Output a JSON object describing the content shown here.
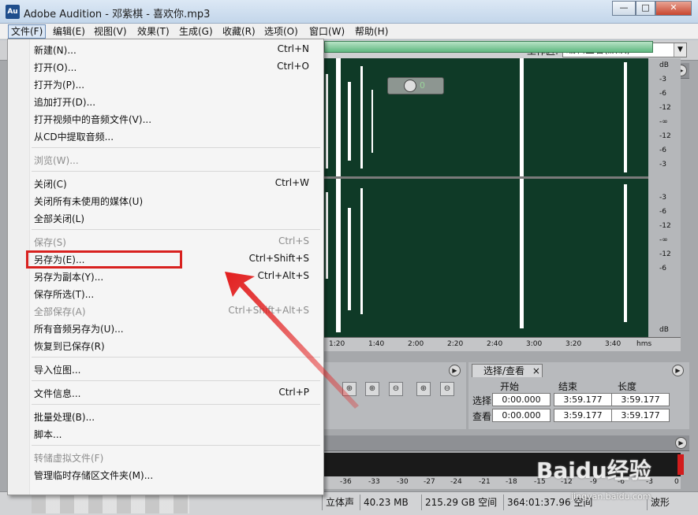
{
  "window": {
    "title": "Adobe Audition - 邓紫棋 - 喜欢你.mp3",
    "icon_text": "Au",
    "controls": {
      "minimize": "—",
      "maximize": "□",
      "close": "✕"
    }
  },
  "menubar": [
    {
      "label": "文件(F)",
      "active": true
    },
    {
      "label": "编辑(E)"
    },
    {
      "label": "视图(V)"
    },
    {
      "label": "效果(T)"
    },
    {
      "label": "生成(G)"
    },
    {
      "label": "收藏(R)"
    },
    {
      "label": "选项(O)"
    },
    {
      "label": "窗口(W)"
    },
    {
      "label": "帮助(H)"
    }
  ],
  "workspace": {
    "label": "工作区:",
    "value": "编辑查看(默认)"
  },
  "file_menu": [
    {
      "label": "新建(N)...",
      "shortcut": "Ctrl+N"
    },
    {
      "label": "打开(O)...",
      "shortcut": "Ctrl+O"
    },
    {
      "label": "打开为(P)...",
      "shortcut": ""
    },
    {
      "label": "追加打开(D)...",
      "shortcut": ""
    },
    {
      "label": "打开视频中的音频文件(V)...",
      "shortcut": ""
    },
    {
      "label": "从CD中提取音频...",
      "shortcut": ""
    },
    {
      "label": "浏览(W)...",
      "shortcut": "",
      "disabled": true
    },
    {
      "label": "关闭(C)",
      "shortcut": "Ctrl+W"
    },
    {
      "label": "关闭所有未使用的媒体(U)",
      "shortcut": ""
    },
    {
      "label": "全部关闭(L)",
      "shortcut": ""
    },
    {
      "label": "保存(S)",
      "shortcut": "Ctrl+S",
      "disabled": true
    },
    {
      "label": "另存为(E)...",
      "shortcut": "Ctrl+Shift+S"
    },
    {
      "label": "另存为副本(Y)...",
      "shortcut": "Ctrl+Alt+S"
    },
    {
      "label": "保存所选(T)...",
      "shortcut": ""
    },
    {
      "label": "全部保存(A)",
      "shortcut": "Ctrl+Shift+Alt+S",
      "disabled": true
    },
    {
      "label": "所有音频另存为(U)...",
      "shortcut": ""
    },
    {
      "label": "恢复到已保存(R)",
      "shortcut": ""
    },
    {
      "label": "导入位图...",
      "shortcut": ""
    },
    {
      "label": "文件信息...",
      "shortcut": "Ctrl+P"
    },
    {
      "label": "批量处理(B)...",
      "shortcut": ""
    },
    {
      "label": "脚本...",
      "shortcut": ""
    },
    {
      "label": "转储虚拟文件(F)",
      "shortcut": "",
      "disabled": true
    },
    {
      "label": "管理临时存储区文件夹(M)...",
      "shortcut": ""
    }
  ],
  "volume_readout": "0",
  "db_scale": [
    "dB",
    "-3",
    "-6",
    "-12",
    "-∞",
    "-12",
    "-6",
    "-3",
    "-3",
    "-6",
    "-12",
    "-∞",
    "-12",
    "-6",
    "dB"
  ],
  "timeline": [
    "1:20",
    "1:40",
    "2:00",
    "2:20",
    "2:40",
    "3:00",
    "3:20",
    "3:40",
    "hms"
  ],
  "selection_panel": {
    "tab": "选择/查看",
    "close": "×",
    "headers": [
      "开始",
      "结束",
      "长度"
    ],
    "rows": [
      {
        "label": "选择",
        "values": [
          "0:00.000",
          "3:59.177",
          "3:59.177"
        ]
      },
      {
        "label": "查看",
        "values": [
          "0:00.000",
          "3:59.177",
          "3:59.177"
        ]
      }
    ]
  },
  "meter_scale": [
    "-36",
    "-33",
    "-30",
    "-27",
    "-24",
    "-21",
    "-18",
    "-15",
    "-12",
    "-9",
    "-6",
    "-3",
    "0"
  ],
  "status": [
    "立体声",
    "40.23 MB",
    "215.29 GB 空间",
    "364:01:37.96 空间",
    "波形"
  ],
  "watermark": {
    "main": "Baidu经验",
    "sub": "jingyan.baidu.com"
  },
  "colors": {
    "highlight": "#d8211f",
    "wave_bg": "#0f3a27",
    "overview": "#5fb780"
  }
}
